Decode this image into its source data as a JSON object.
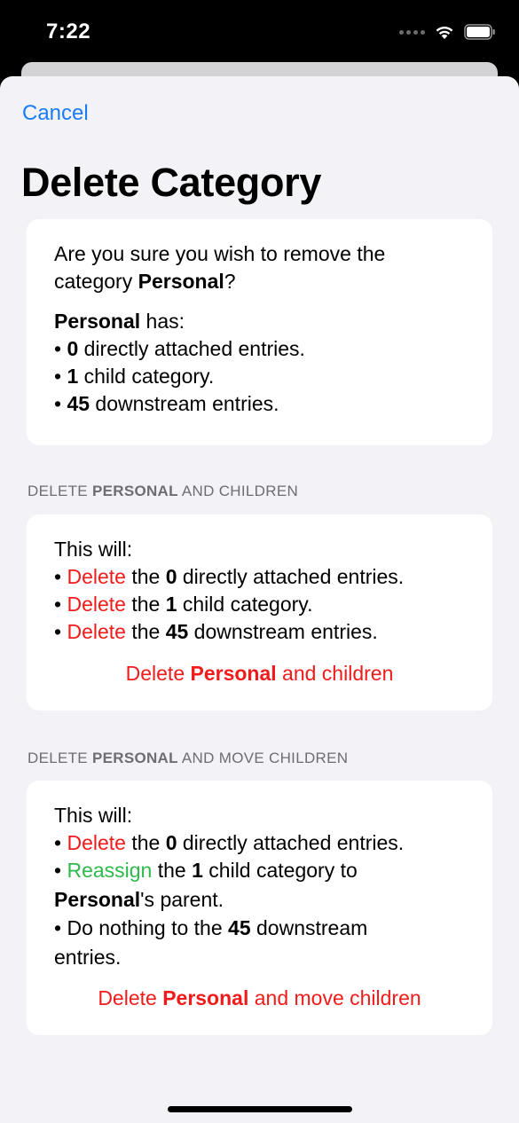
{
  "status": {
    "time": "7:22"
  },
  "nav": {
    "cancel_label": "Cancel",
    "title": "Delete Category"
  },
  "category_name": "Personal",
  "summary": {
    "question_a": "Are you sure you wish to remove the",
    "question_b_prefix": "category ",
    "question_b_suffix": "?",
    "has_suffix": " has:",
    "bullet": "• ",
    "direct_count": "0",
    "direct_text": " directly attached entries.",
    "child_count": "1",
    "child_text": " child category.",
    "downstream_count": "45",
    "downstream_text": " downstream entries."
  },
  "section_delete_children": {
    "header_prefix": "DELETE ",
    "header_name": "PERSONAL",
    "header_suffix": " AND CHILDREN",
    "intro": "This will:",
    "bullet": "• ",
    "delete_word": "Delete",
    "the_word": " the ",
    "direct_count": "0",
    "direct_text": " directly attached entries.",
    "child_count": "1",
    "child_text": " child category.",
    "downstream_count": "45",
    "downstream_text": " downstream entries.",
    "action_prefix": "Delete ",
    "action_name": "Personal",
    "action_suffix": " and children"
  },
  "section_move_children": {
    "header_prefix": "DELETE ",
    "header_name": "PERSONAL",
    "header_suffix": " AND MOVE CHILDREN",
    "intro": "This will:",
    "bullet": "• ",
    "delete_word": "Delete",
    "the_word": " the ",
    "direct_count": "0",
    "direct_text": " directly attached entries.",
    "reassign_word": "Reassign",
    "child_count": "1",
    "child_text": " child category to",
    "parent_name": "Personal",
    "parent_suffix": "'s parent.",
    "nothing_prefix": "Do nothing to the ",
    "downstream_count": "45",
    "downstream_text": " downstream",
    "downstream_text2": "entries.",
    "action_prefix": "Delete ",
    "action_name": "Personal",
    "action_suffix": " and move children"
  },
  "colors": {
    "accent": "#1a7cf5",
    "destructive": "#f21b1b",
    "positive": "#2fb94c"
  }
}
